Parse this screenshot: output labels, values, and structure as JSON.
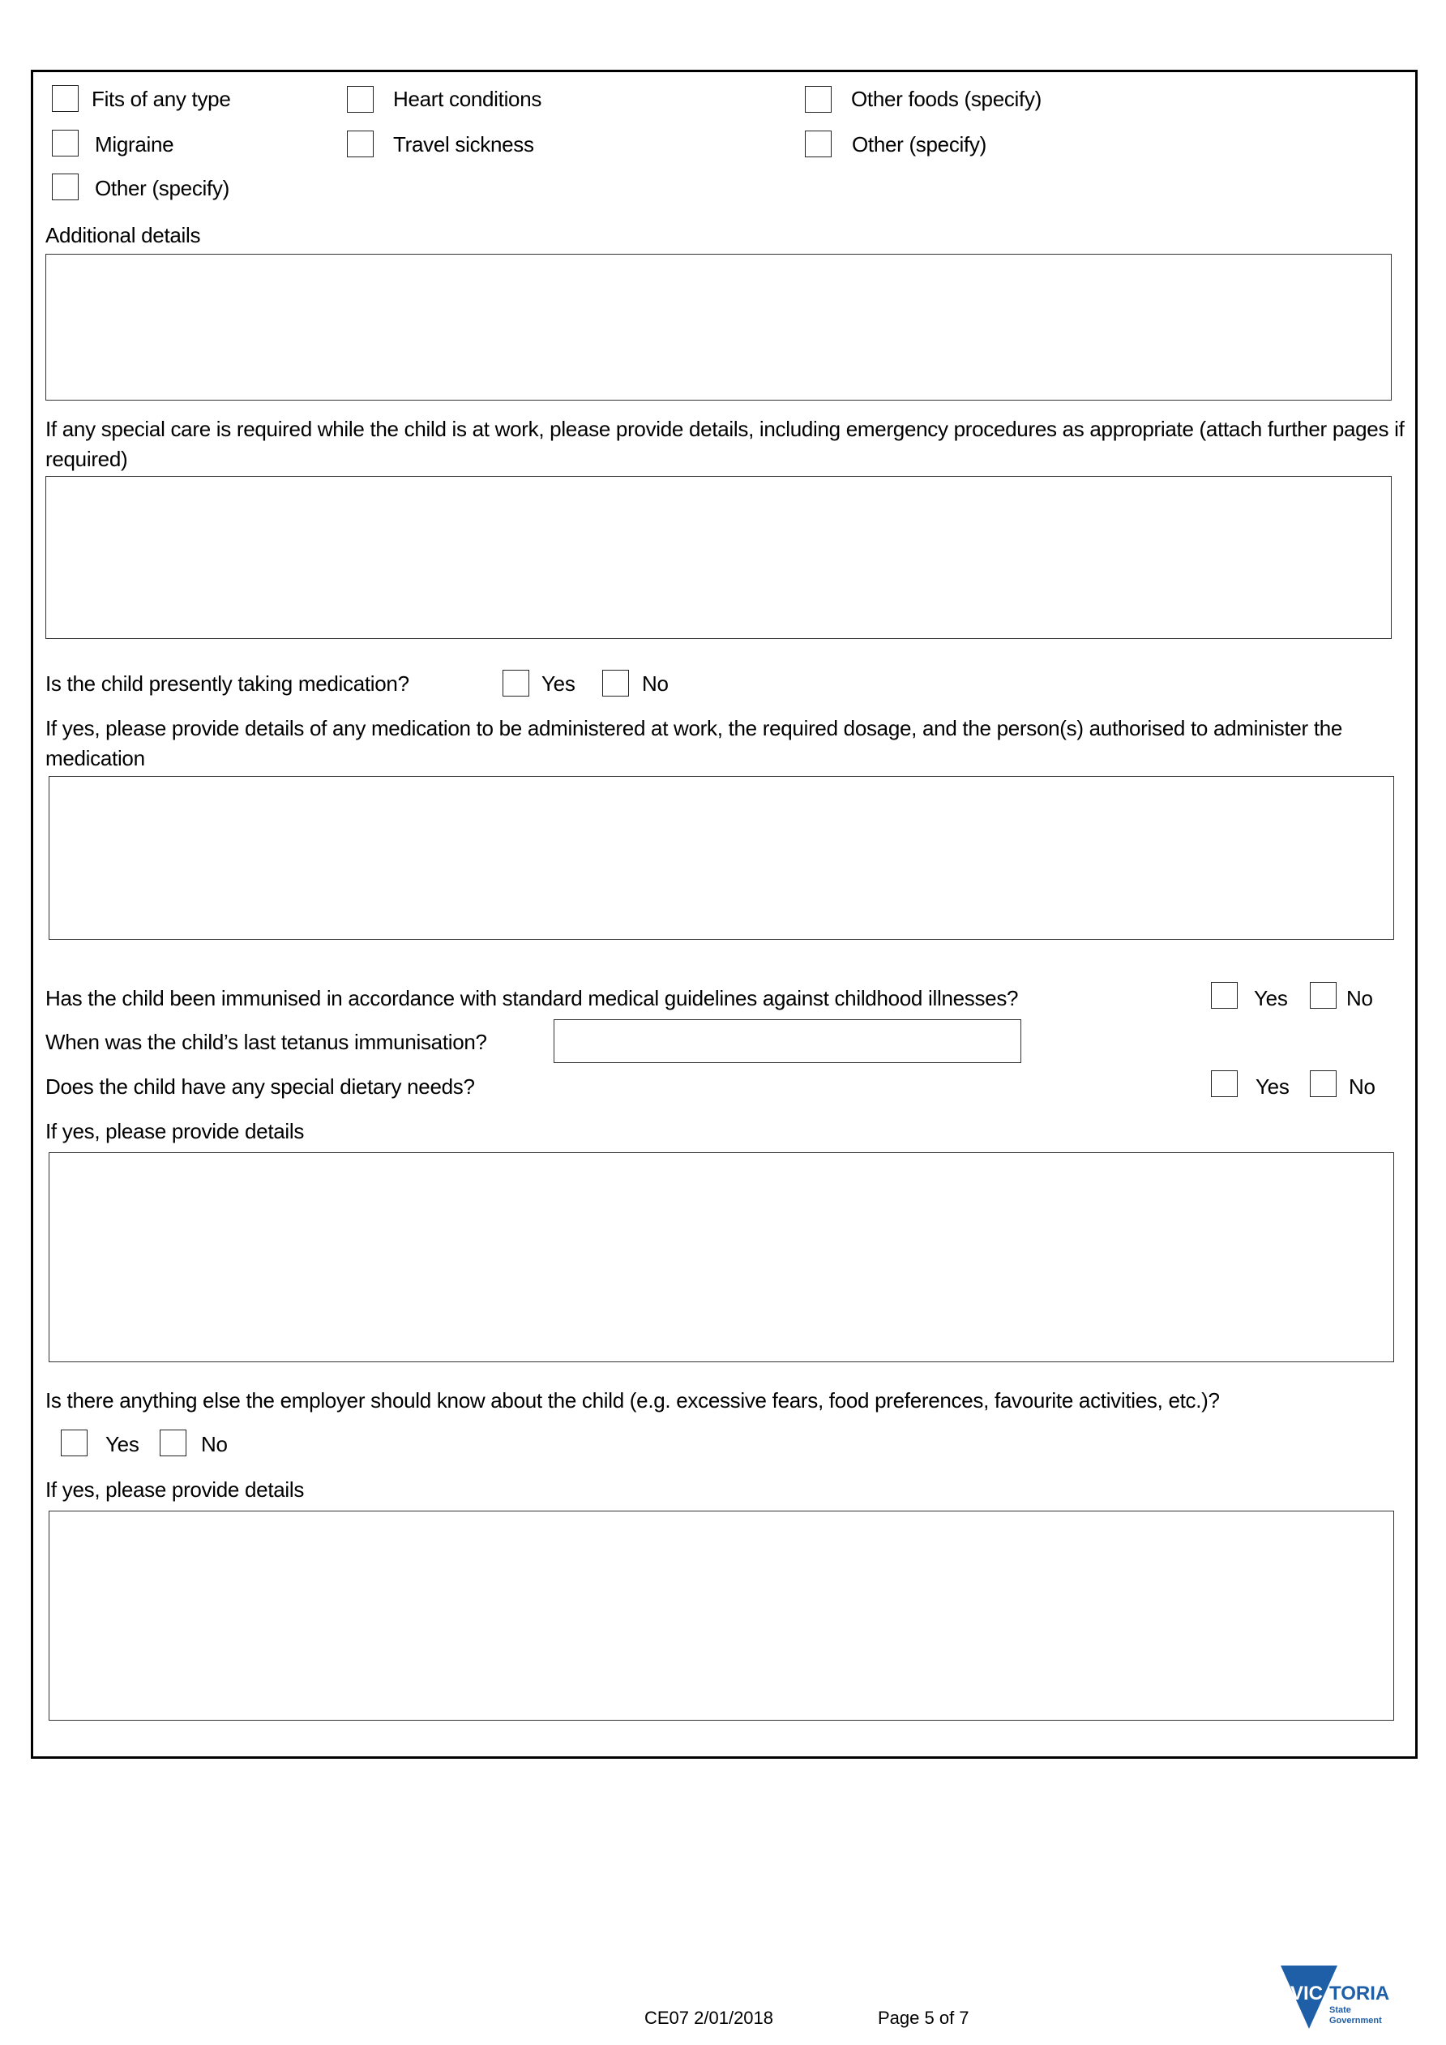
{
  "conditions": {
    "col1": [
      "Fits of any type",
      "Migraine",
      "Other (specify)"
    ],
    "col2": [
      "Heart conditions",
      "Travel sickness"
    ],
    "col3": [
      "Other foods (specify)",
      "Other (specify)"
    ]
  },
  "additional_details": {
    "label": "Additional details",
    "value": ""
  },
  "special_care": {
    "label": "If any special care is required while the child is at work, please provide details, including emergency procedures as appropriate (attach further pages if required)",
    "value": ""
  },
  "medication": {
    "question": "Is the child presently taking medication?",
    "yes_label": "Yes",
    "no_label": "No",
    "details_label": "If yes, please provide details of any medication to be administered at work, the required dosage, and the person(s) authorised to administer the medication",
    "value": ""
  },
  "immunised": {
    "question": "Has the child been immunised in accordance with standard medical guidelines against childhood illnesses?",
    "yes_label": "Yes",
    "no_label": "No"
  },
  "tetanus": {
    "question": "When was the child’s last tetanus immunisation?",
    "value": ""
  },
  "dietary": {
    "question": "Does the child have any special dietary needs?",
    "yes_label": "Yes",
    "no_label": "No",
    "details_label": "If yes, please provide details",
    "value": ""
  },
  "anything_else": {
    "question": "Is there anything else the employer should know about the child (e.g. excessive fears, food preferences, favourite activities, etc.)?",
    "yes_label": "Yes",
    "no_label": "No",
    "details_label": "If yes, please provide details",
    "value": ""
  },
  "footer": {
    "form_code": "CE07 2/01/2018",
    "page": "Page 5 of 7",
    "logo_main": "VICTORIA",
    "logo_line1": "State",
    "logo_line2": "Government",
    "logo_color": "#1F5FA8"
  }
}
